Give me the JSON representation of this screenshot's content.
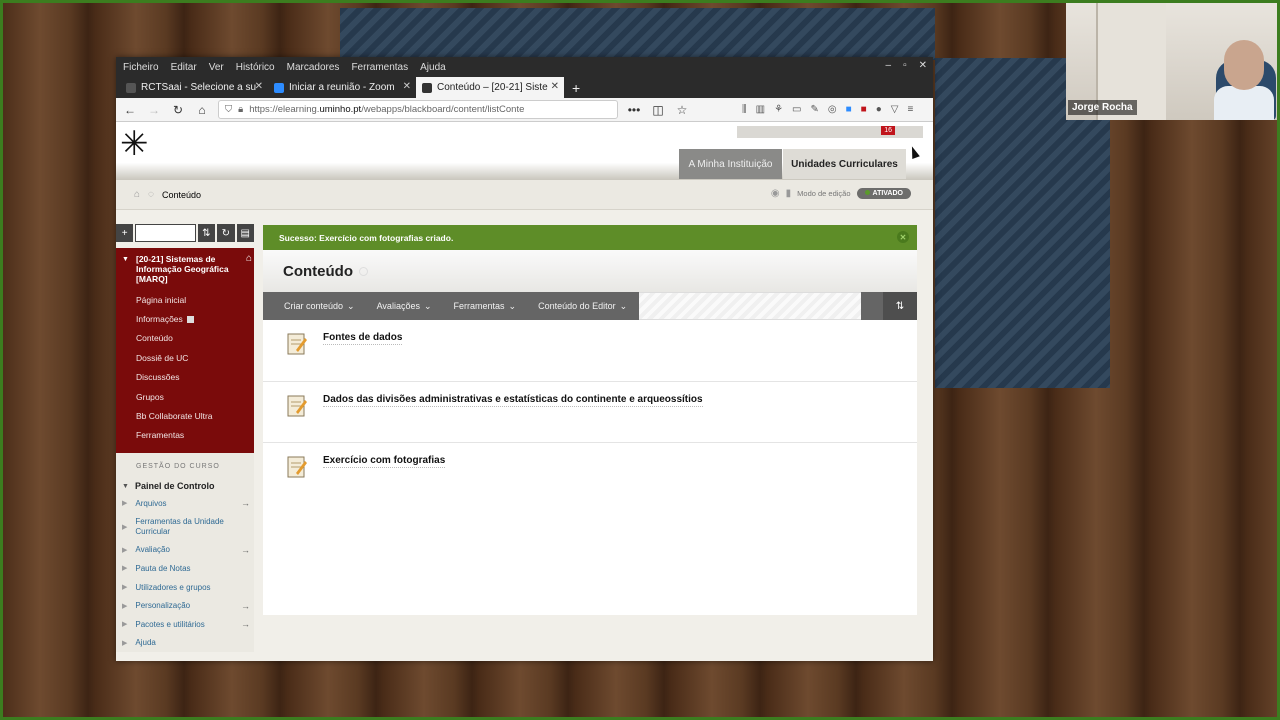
{
  "participant": {
    "name": "Jorge Rocha"
  },
  "menubar": [
    "Ficheiro",
    "Editar",
    "Ver",
    "Histórico",
    "Marcadores",
    "Ferramentas",
    "Ajuda"
  ],
  "tabs": [
    {
      "label": "RCTSaai - Selecione a su",
      "icon_color": "#555555"
    },
    {
      "label": "Iniciar a reunião - Zoom",
      "icon_color": "#2d8cff"
    },
    {
      "label": "Conteúdo – [20-21] Siste",
      "icon_color": "#333333"
    }
  ],
  "url": {
    "prefix": "https://elearning.",
    "domain": "uminho.pt",
    "path": "/webapps/blackboard/content/listConte"
  },
  "header": {
    "tab_institution": "A Minha Instituição",
    "tab_courses": "Unidades Curriculares",
    "notification_count": "16"
  },
  "breadcrumb": {
    "current": "Conteúdo"
  },
  "edit_mode": {
    "label": "Modo de edição",
    "state": "ATIVADO"
  },
  "course_menu": {
    "title": "[20-21] Sistemas de Informação Geográfica [MARQ]",
    "items": [
      "Página inicial",
      "Informações",
      "Conteúdo",
      "Dossiê de UC",
      "Discussões",
      "Grupos",
      "Bb Collaborate Ultra",
      "Ferramentas"
    ]
  },
  "management": {
    "heading": "GESTÃO DO CURSO",
    "panel": "Painel de Controlo",
    "items": [
      "Arquivos",
      "Ferramentas da Unidade Curricular",
      "Avaliação",
      "Pauta de Notas",
      "Utilizadores e grupos",
      "Personalização",
      "Pacotes e utilitários",
      "Ajuda"
    ]
  },
  "content": {
    "success_message": "Sucesso: Exercício com fotografias criado.",
    "title": "Conteúdo",
    "actions": [
      "Criar conteúdo",
      "Avaliações",
      "Ferramentas",
      "Conteúdo do Editor"
    ],
    "items": [
      "Fontes de dados",
      "Dados das divisões administrativas e estatísticas do continente e arqueossítios",
      "Exercício com fotografias"
    ]
  }
}
